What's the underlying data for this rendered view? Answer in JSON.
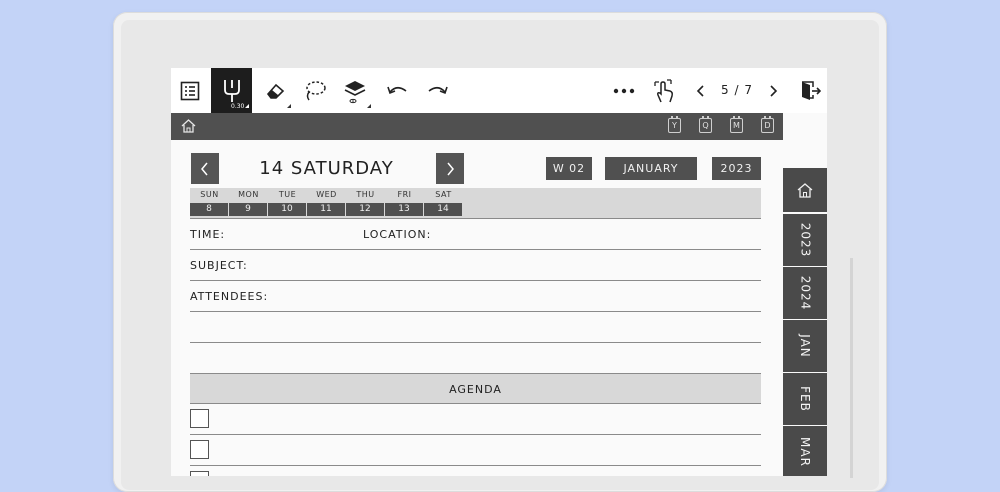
{
  "toolbar": {
    "icons": [
      "list-icon",
      "pen-icon",
      "eraser-icon",
      "lasso-icon",
      "layers-icon",
      "undo-icon",
      "redo-icon",
      "more-icon",
      "touch-icon",
      "prev-page-icon",
      "next-page-icon",
      "exit-icon"
    ],
    "pen_size": "0.30",
    "page_indicator": "5 / 7"
  },
  "topbar": {
    "mini_links": [
      "Y",
      "Q",
      "M",
      "D"
    ]
  },
  "date_header": {
    "title": "14 SATURDAY",
    "week_chip": "W 02",
    "month_chip": "JANUARY",
    "year_chip": "2023"
  },
  "week_strip": {
    "days": [
      {
        "label": "SUN",
        "num": "8"
      },
      {
        "label": "MON",
        "num": "9"
      },
      {
        "label": "TUE",
        "num": "10"
      },
      {
        "label": "WED",
        "num": "11"
      },
      {
        "label": "THU",
        "num": "12"
      },
      {
        "label": "FRI",
        "num": "13"
      },
      {
        "label": "SAT",
        "num": "14"
      }
    ]
  },
  "fields": {
    "time": "TIME:",
    "location": "LOCATION:",
    "subject": "SUBJECT:",
    "attendees": "ATTENDEES:"
  },
  "agenda": {
    "title": "AGENDA"
  },
  "side_tabs": [
    "2023",
    "2024",
    "JAN",
    "FEB",
    "MAR"
  ],
  "colors": {
    "background": "#c3d3f7",
    "dark_gray": "#505050",
    "light_gray": "#d8d8d8"
  }
}
